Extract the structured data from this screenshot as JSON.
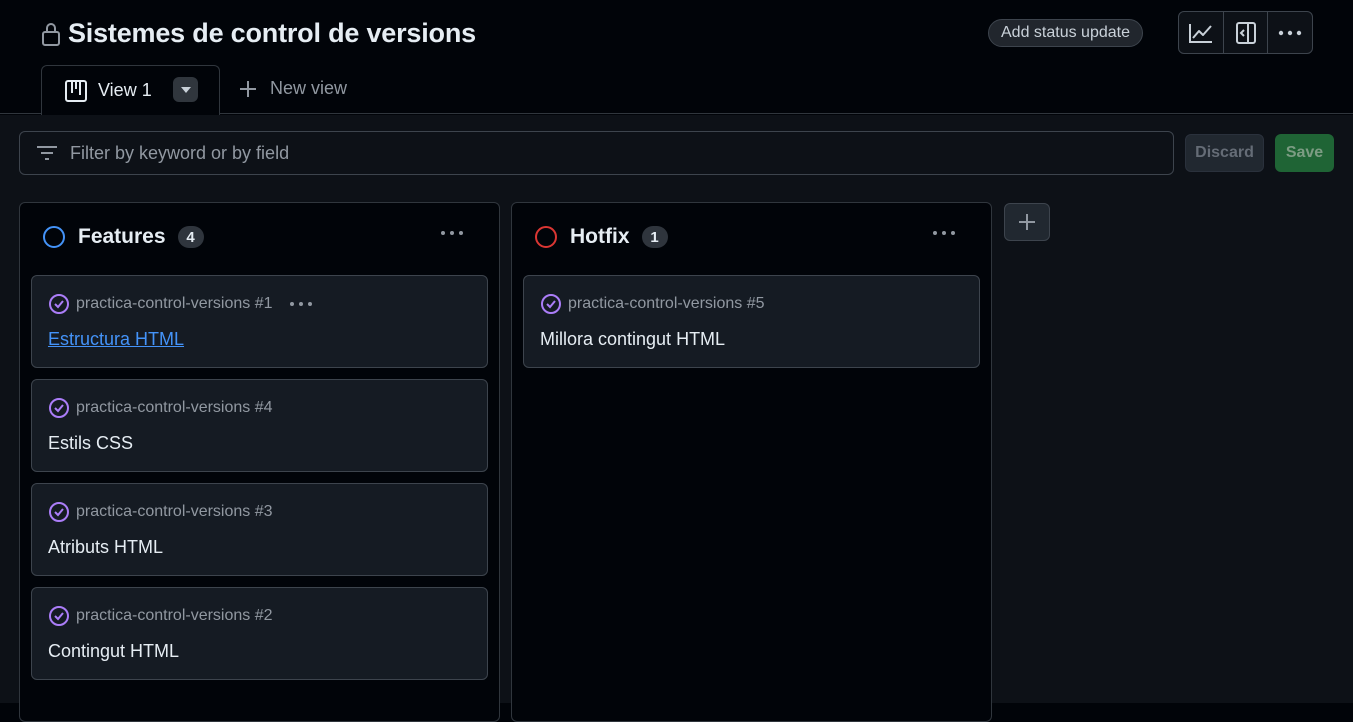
{
  "header": {
    "title": "Sistemes de control de versions",
    "status_update_label": "Add status update"
  },
  "tabs": {
    "active_label": "View 1",
    "new_view_label": "New view"
  },
  "filter": {
    "placeholder": "Filter by keyword or by field",
    "discard_label": "Discard",
    "save_label": "Save"
  },
  "columns": [
    {
      "name": "Features",
      "count": "4",
      "status_color": "#4493f8",
      "cards": [
        {
          "repo": "practica-control-versions #1",
          "title": "Estructura HTML"
        },
        {
          "repo": "practica-control-versions #4",
          "title": "Estils CSS"
        },
        {
          "repo": "practica-control-versions #3",
          "title": "Atributs HTML"
        },
        {
          "repo": "practica-control-versions #2",
          "title": "Contingut HTML"
        }
      ]
    },
    {
      "name": "Hotfix",
      "count": "1",
      "status_color": "#da3633",
      "cards": [
        {
          "repo": "practica-control-versions #5",
          "title": "Millora contingut HTML"
        }
      ]
    }
  ],
  "icons": {
    "issue_closed_color": "#ab7df8",
    "lock": "lock-icon",
    "insights": "graph-icon",
    "side_panel": "sidebar-icon",
    "more": "kebab-icon",
    "board": "project-board-icon",
    "filter": "filter-icon",
    "add": "plus-icon"
  }
}
